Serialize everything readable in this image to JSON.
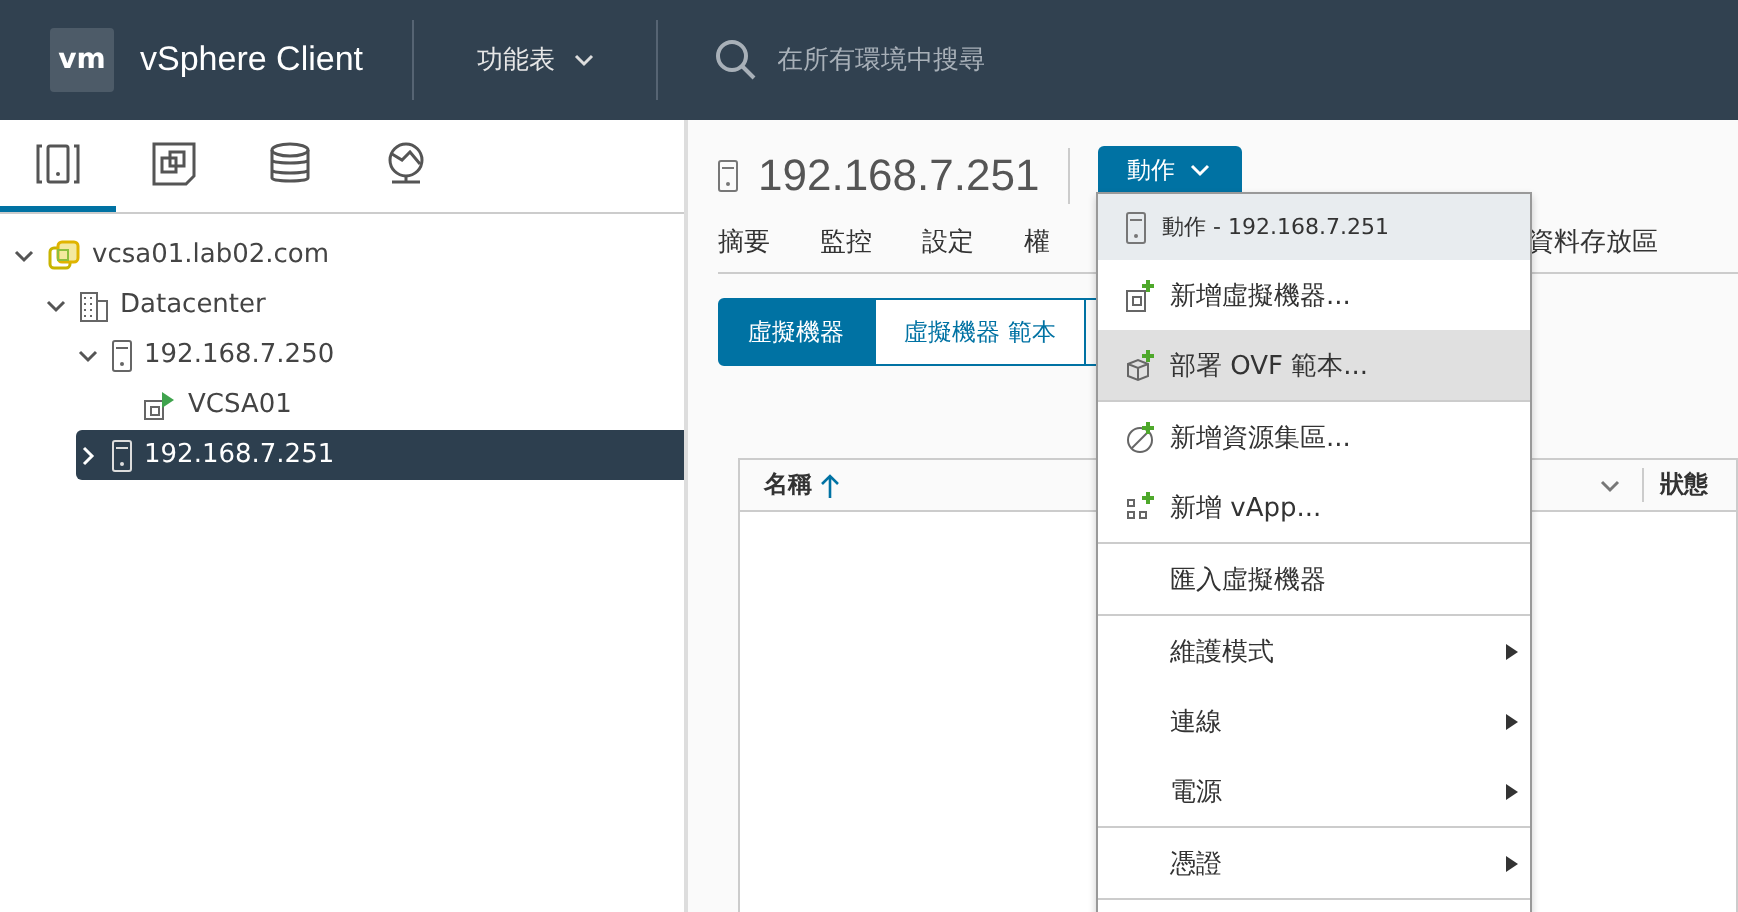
{
  "header": {
    "logo": "vm",
    "title": "vSphere Client",
    "menu": "功能表",
    "search": {
      "placeholder": "在所有環境中搜尋"
    }
  },
  "nav_tabs": [
    {
      "kind": "hosts",
      "selected": true
    },
    {
      "kind": "vms",
      "selected": false
    },
    {
      "kind": "storage",
      "selected": false
    },
    {
      "kind": "network",
      "selected": false
    }
  ],
  "tree": [
    {
      "kind": "vcenter",
      "label": "vcsa01.lab02.com",
      "expanded": true,
      "selected": false,
      "children": [
        {
          "kind": "datacenter",
          "label": "Datacenter",
          "expanded": true,
          "selected": false,
          "children": [
            {
              "kind": "host",
              "label": "192.168.7.250",
              "expanded": true,
              "selected": false,
              "children": [
                {
                  "kind": "vm",
                  "label": "VCSA01",
                  "selected": false
                }
              ]
            },
            {
              "kind": "host",
              "label": "192.168.7.251",
              "expanded": false,
              "selected": true
            }
          ]
        }
      ]
    }
  ],
  "object": {
    "title": "192.168.7.251",
    "actions_button": "動作"
  },
  "tabs": [
    {
      "label": "摘要",
      "selected": false
    },
    {
      "label": "監控",
      "selected": false
    },
    {
      "label": "設定",
      "selected": false
    },
    {
      "label": "權",
      "selected": false
    },
    {
      "label": "資料存放區",
      "selected": false
    }
  ],
  "sub_tabs": [
    {
      "label": "虛擬機器",
      "selected": true
    },
    {
      "label": "虛擬機器 範本",
      "selected": false
    }
  ],
  "table": {
    "columns": [
      "名稱",
      "狀態"
    ]
  },
  "actions_menu": {
    "title": "動作 - 192.168.7.251",
    "sections": [
      [
        {
          "kind": "add-vm",
          "label": "新增虛擬機器...",
          "selected": false,
          "submenu": false
        },
        {
          "kind": "deploy",
          "label": "部署 OVF 範本...",
          "selected": true,
          "submenu": false
        }
      ],
      [
        {
          "kind": "pool",
          "label": "新增資源集區...",
          "selected": false,
          "submenu": false
        },
        {
          "kind": "vapp",
          "label": "新增 vApp...",
          "selected": false,
          "submenu": false
        }
      ],
      [
        {
          "kind": "none",
          "label": "匯入虛擬機器",
          "selected": false,
          "submenu": false
        }
      ],
      [
        {
          "kind": "none",
          "label": "維護模式",
          "selected": false,
          "submenu": true
        },
        {
          "kind": "none",
          "label": "連線",
          "selected": false,
          "submenu": true
        },
        {
          "kind": "none",
          "label": "電源",
          "selected": false,
          "submenu": true
        }
      ],
      [
        {
          "kind": "none",
          "label": "憑證",
          "selected": false,
          "submenu": true
        }
      ]
    ]
  }
}
